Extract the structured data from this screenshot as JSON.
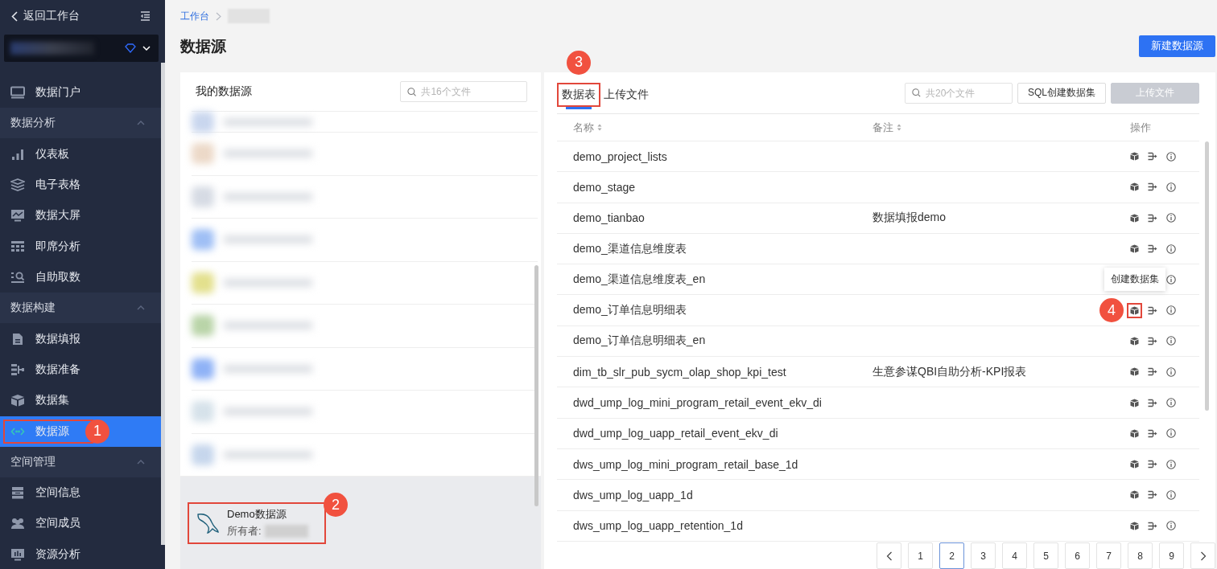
{
  "sidebar": {
    "back_label": "返回工作台",
    "nav": [
      {
        "kind": "item",
        "label": "数据门户",
        "selected": false
      },
      {
        "kind": "group",
        "label": "数据分析",
        "expanded": true,
        "children": [
          {
            "label": "仪表板",
            "selected": false
          },
          {
            "label": "电子表格",
            "selected": false
          },
          {
            "label": "数据大屏",
            "selected": false
          },
          {
            "label": "即席分析",
            "selected": false
          },
          {
            "label": "自助取数",
            "selected": false
          }
        ]
      },
      {
        "kind": "group",
        "label": "数据构建",
        "expanded": true,
        "children": [
          {
            "label": "数据填报",
            "selected": false
          },
          {
            "label": "数据准备",
            "selected": false
          },
          {
            "label": "数据集",
            "selected": false
          },
          {
            "label": "数据源",
            "selected": true,
            "callout": "1"
          }
        ]
      },
      {
        "kind": "group",
        "label": "空间管理",
        "expanded": true,
        "children": [
          {
            "label": "空间信息",
            "selected": false
          },
          {
            "label": "空间成员",
            "selected": false
          },
          {
            "label": "资源分析",
            "selected": false
          }
        ]
      }
    ]
  },
  "breadcrumb": [
    {
      "label": "工作台"
    }
  ],
  "page_title": "数据源",
  "new_button": "新建数据源",
  "sources_panel": {
    "title": "我的数据源",
    "search": {
      "placeholder": "共16个文件"
    },
    "selected_source": {
      "name": "Demo数据源",
      "owner_label": "所有者:",
      "selected": true,
      "callout": "2"
    }
  },
  "tables_panel": {
    "tabs": [
      {
        "label": "数据表",
        "selected": true,
        "callout": "3"
      },
      {
        "label": "上传文件",
        "selected": false
      }
    ],
    "search": {
      "placeholder": "共20个文件"
    },
    "buttons": [
      {
        "label": "SQL创建数据集",
        "disabled": false
      },
      {
        "label": "上传文件",
        "disabled": true
      }
    ],
    "columns": [
      {
        "label": "名称",
        "sortable": true
      },
      {
        "label": "备注",
        "sortable": true
      },
      {
        "label": "操作",
        "sortable": false
      }
    ],
    "rows": [
      {
        "name": "demo_project_lists"
      },
      {
        "name": "demo_stage"
      },
      {
        "name": "demo_tianbao",
        "remark": "数据填报demo"
      },
      {
        "name": "demo_渠道信息维度表"
      },
      {
        "name": "demo_渠道信息维度表_en"
      },
      {
        "name": "demo_订单信息明细表",
        "tooltip": "创建数据集",
        "callout": "4"
      },
      {
        "name": "demo_订单信息明细表_en"
      },
      {
        "name": "dim_tb_slr_pub_sycm_olap_shop_kpi_test",
        "remark": "生意参谋QBI自助分析-KPI报表"
      },
      {
        "name": "dwd_ump_log_mini_program_retail_event_ekv_di"
      },
      {
        "name": "dwd_ump_log_uapp_retail_event_ekv_di"
      },
      {
        "name": "dws_ump_log_mini_program_retail_base_1d"
      },
      {
        "name": "dws_ump_log_uapp_1d"
      },
      {
        "name": "dws_ump_log_uapp_retention_1d"
      }
    ],
    "pagination": [
      {
        "label": "1",
        "selected": false
      },
      {
        "label": "2",
        "selected": true
      },
      {
        "label": "3",
        "selected": false
      },
      {
        "label": "4",
        "selected": false
      },
      {
        "label": "5",
        "selected": false
      },
      {
        "label": "6",
        "selected": false
      },
      {
        "label": "7",
        "selected": false
      },
      {
        "label": "8",
        "selected": false
      },
      {
        "label": "9",
        "selected": false
      }
    ]
  }
}
